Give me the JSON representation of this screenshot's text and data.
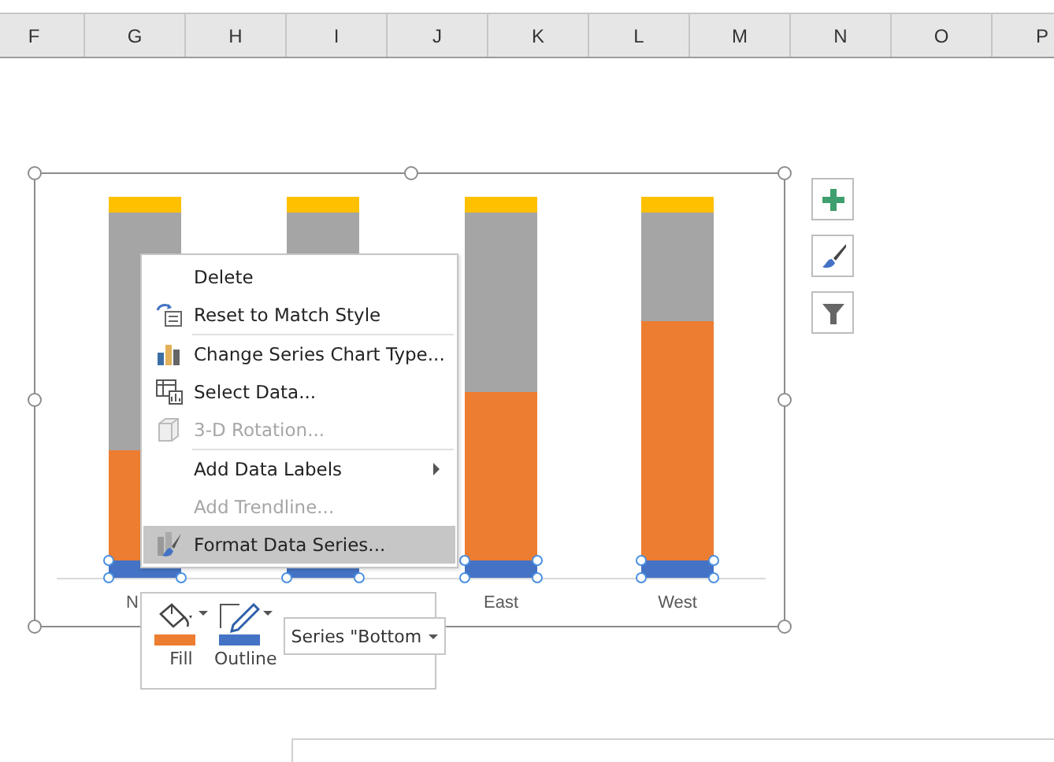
{
  "columns": [
    "F",
    "G",
    "H",
    "I",
    "J",
    "K",
    "L",
    "M",
    "N",
    "O",
    "P"
  ],
  "chart": {
    "category_labels": [
      {
        "label": "N"
      },
      {
        "label": "East"
      },
      {
        "label": "West"
      }
    ]
  },
  "chart_buttons": [
    {
      "kind": "plus"
    },
    {
      "kind": "brush"
    },
    {
      "kind": "filter"
    }
  ],
  "context_menu": [
    {
      "kind": "item",
      "label": "Delete",
      "disabled": false,
      "selected": false,
      "submenu": false
    },
    {
      "kind": "item",
      "label": "Reset to Match Style",
      "disabled": false,
      "selected": false,
      "submenu": false
    },
    {
      "kind": "separator"
    },
    {
      "kind": "item",
      "label": "Change Series Chart Type...",
      "disabled": false,
      "selected": false,
      "submenu": false
    },
    {
      "kind": "item",
      "label": "Select Data...",
      "disabled": false,
      "selected": false,
      "submenu": false
    },
    {
      "kind": "item",
      "label": "3-D Rotation...",
      "disabled": true,
      "selected": false,
      "submenu": false
    },
    {
      "kind": "separator"
    },
    {
      "kind": "item",
      "label": "Add Data Labels",
      "disabled": false,
      "selected": false,
      "submenu": true
    },
    {
      "kind": "item",
      "label": "Add Trendline...",
      "disabled": true,
      "selected": false,
      "submenu": false
    },
    {
      "kind": "item",
      "label": "Format Data Series...",
      "disabled": false,
      "selected": true,
      "submenu": false
    }
  ],
  "mini_toolbar": {
    "buttons": [
      {
        "kind": "fill",
        "label": "Fill",
        "color": "#ed7d31"
      },
      {
        "kind": "outline",
        "label": "Outline",
        "color": "#4472c4"
      }
    ],
    "series_dropdown": "Series \"Bottom"
  }
}
